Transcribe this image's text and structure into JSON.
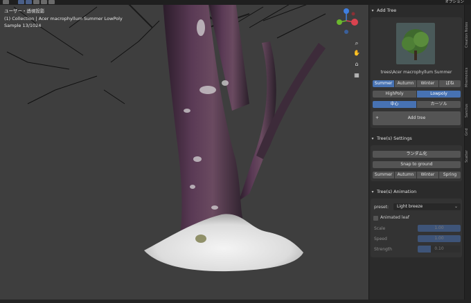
{
  "viewport": {
    "view_name": "ユーザー・透視投影",
    "collection_info": "(1) Collection | Acer macrophyllum Summer LowPoly",
    "sample": "Sample 13/1024"
  },
  "topbar": {
    "right_label": "オプション"
  },
  "sidebar_tabs": [
    "Scatter",
    "Grid",
    "Sanctus",
    "Mnemonics",
    "Creation Notes"
  ],
  "add_tree": {
    "header": "Add Tree",
    "preview_name": "trees\\Acer macrophyllum Summer",
    "seasons": [
      "Summer",
      "Autumn",
      "Winter",
      "ばね"
    ],
    "season_selected": 0,
    "poly": [
      "HighPoly",
      "Lowpoly"
    ],
    "poly_selected": 1,
    "origin": [
      "中心",
      "カーソル"
    ],
    "origin_selected": 0,
    "add_button": "Add tree"
  },
  "tree_settings": {
    "header": "Tree(s) Settings",
    "randomize": "ランダム化",
    "snap": "Snap to ground",
    "seasons": [
      "Summer",
      "Autumn",
      "Winter",
      "Spring"
    ]
  },
  "tree_animation": {
    "header": "Tree(s) Animation",
    "preset_label": "preset:",
    "preset_value": "Light breeze",
    "animated_leaf": "Animated leaf",
    "animated_leaf_checked": false,
    "scale_label": "Scale",
    "scale_value": "1.00",
    "scale_fraction": 1.0,
    "speed_label": "Speed",
    "speed_value": "1.00",
    "speed_fraction": 1.0,
    "strength_label": "Strength",
    "strength_value": "0.10",
    "strength_fraction": 0.31
  },
  "colors": {
    "accent": "#4772b3",
    "panel_bg": "#2b2b2b",
    "viewport_bg": "#3e3e3e",
    "gizmo_x": "#d9434f",
    "gizmo_y": "#6bb82d",
    "gizmo_z": "#3f7fe0"
  }
}
